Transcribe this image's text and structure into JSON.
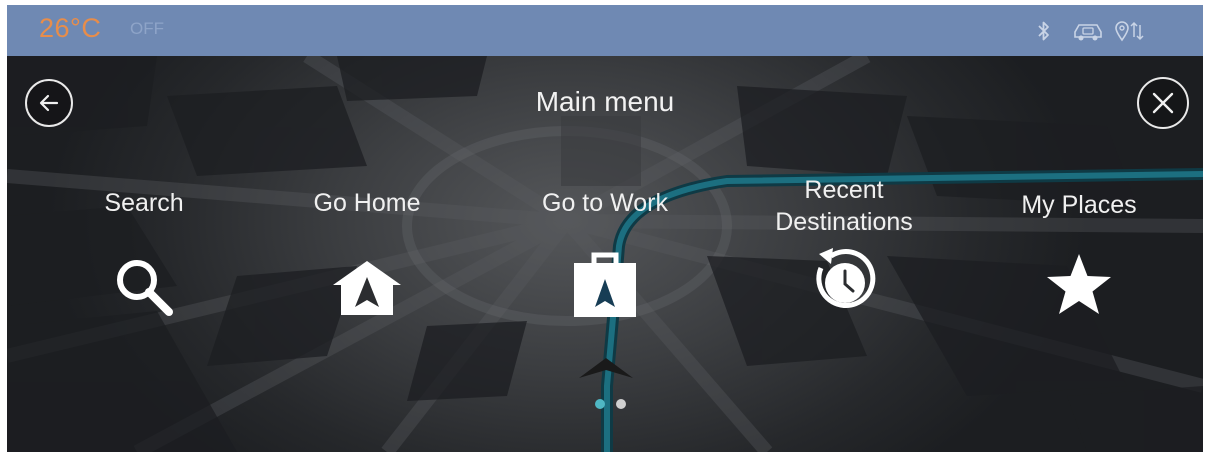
{
  "status": {
    "temperature": "26°C",
    "ac_state": "OFF",
    "icons": [
      "bluetooth-icon",
      "car-connectivity-icon",
      "location-sharing-icon"
    ],
    "temperature_color": "#e88d4a",
    "bar_color": "#6f89b3"
  },
  "header": {
    "title": "Main menu",
    "back_icon": "arrow-left-icon",
    "close_icon": "close-icon"
  },
  "menu": [
    {
      "label": "Search",
      "icon": "search-icon"
    },
    {
      "label": "Go Home",
      "icon": "home-icon"
    },
    {
      "label": "Go to Work",
      "icon": "work-icon"
    },
    {
      "label": "Recent\nDestinations",
      "label_line1": "Recent",
      "label_line2": "Destinations",
      "icon": "recent-destinations-icon"
    },
    {
      "label": "My Places",
      "icon": "star-icon"
    }
  ],
  "pagination": {
    "pages": 2,
    "current": 1,
    "active_color": "#4fb7c4",
    "inactive_color": "#d0d0d0"
  }
}
